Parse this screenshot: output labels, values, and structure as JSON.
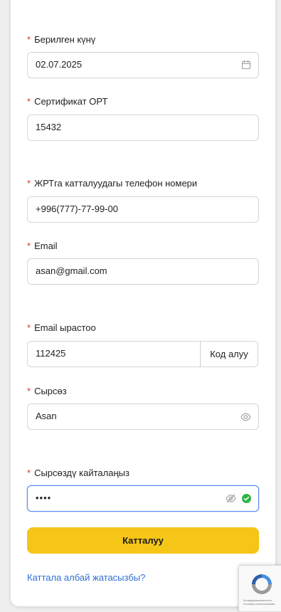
{
  "form": {
    "issue_date": {
      "label": "Берилген күнү",
      "value": "02.07.2025"
    },
    "ort_certificate": {
      "label": "Сертификат ОРТ",
      "value": "15432"
    },
    "phone": {
      "label": "ЖРТга катталуудагы телефон номери",
      "value": "+996(777)-77-99-00"
    },
    "email": {
      "label": "Email",
      "value": "asan@gmail.com"
    },
    "email_confirm": {
      "label": "Email ырастоо",
      "value": "112425",
      "button": "Код алуу"
    },
    "password": {
      "label": "Сырсөз",
      "value": "Asan"
    },
    "password_repeat": {
      "label": "Сырсөздү кайталаңыз",
      "value": "••••"
    },
    "required_mark": "*",
    "submit_label": "Катталуу",
    "help_link": "Каттала албай жатасызбы?"
  },
  "recaptcha": {
    "text_line1": "Конфиденциальность",
    "text_line2": "Условия использования"
  },
  "colors": {
    "accent_button": "#f5c518",
    "link": "#2f6fd6",
    "required": "#e03131",
    "focus_border": "#5b8def",
    "valid_check": "#2fb344"
  },
  "icons": [
    "calendar-icon",
    "eye-icon",
    "eye-off-icon",
    "check-circle-icon",
    "recaptcha-logo-icon"
  ]
}
